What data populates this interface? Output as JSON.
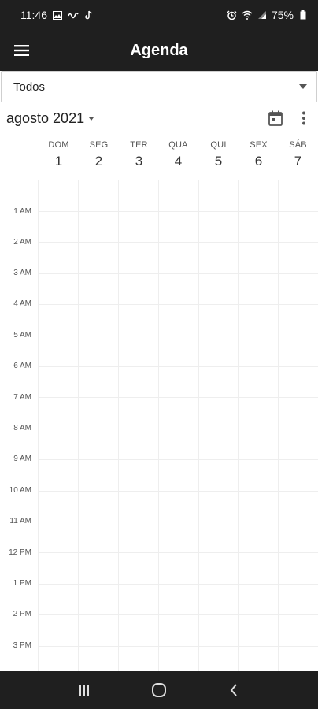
{
  "status_bar": {
    "time": "11:46",
    "battery": "75%",
    "icons": [
      "gallery-icon",
      "wave-icon",
      "tiktok-icon",
      "alarm-icon",
      "wifi-icon",
      "signal-icon",
      "battery-icon"
    ]
  },
  "app_bar": {
    "title": "Agenda",
    "menu_icon": "hamburger-menu-icon"
  },
  "filter": {
    "selected": "Todos"
  },
  "calendar": {
    "month_label": "agosto 2021",
    "days": [
      {
        "name": "DOM",
        "number": "1"
      },
      {
        "name": "SEG",
        "number": "2"
      },
      {
        "name": "TER",
        "number": "3"
      },
      {
        "name": "QUA",
        "number": "4"
      },
      {
        "name": "QUI",
        "number": "5"
      },
      {
        "name": "SEX",
        "number": "6"
      },
      {
        "name": "SÁB",
        "number": "7"
      }
    ],
    "hours": [
      "1 AM",
      "2 AM",
      "3 AM",
      "4 AM",
      "5 AM",
      "6 AM",
      "7 AM",
      "8 AM",
      "9 AM",
      "10 AM",
      "11 AM",
      "12 PM",
      "1 PM",
      "2 PM",
      "3 PM"
    ]
  },
  "colors": {
    "bar_background": "#1f1f1f",
    "grid_line": "#eeeeee"
  }
}
